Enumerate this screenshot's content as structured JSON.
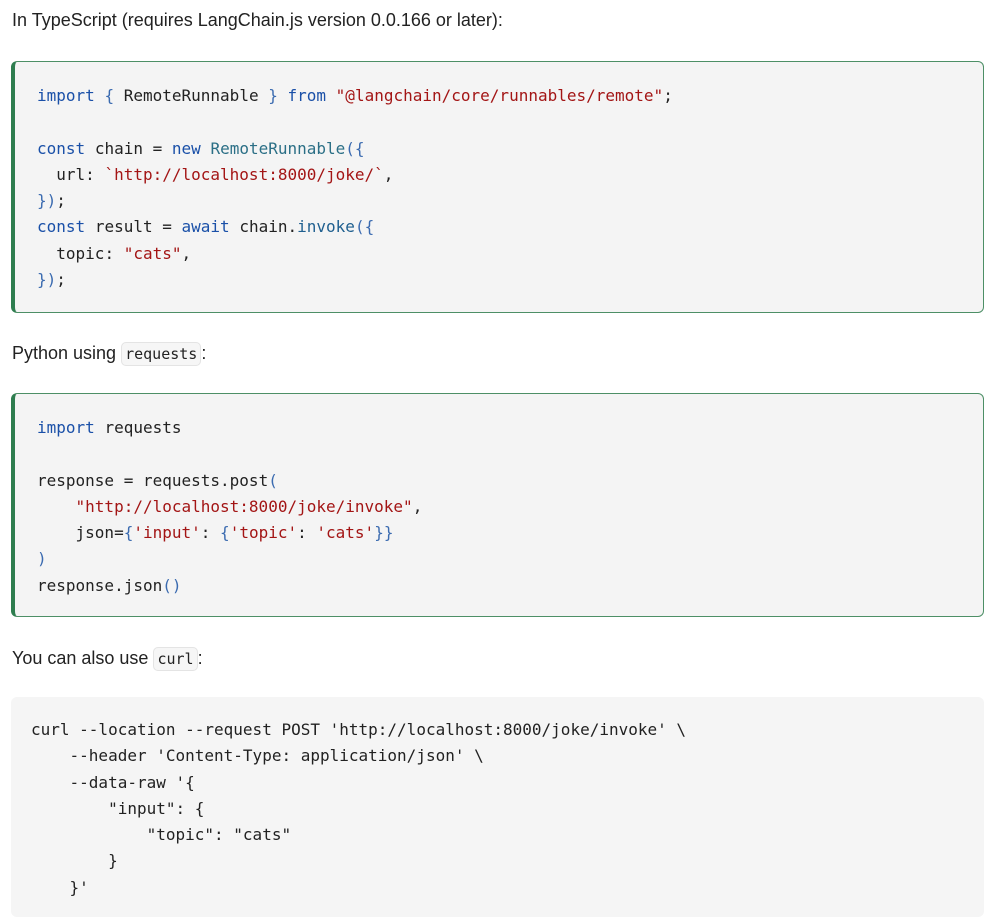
{
  "paragraphs": {
    "ts_intro": "In TypeScript (requires LangChain.js version 0.0.166 or later):",
    "py_intro_prefix": "Python using ",
    "py_intro_code": "requests",
    "py_intro_suffix": ":",
    "curl_intro_prefix": "You can also use ",
    "curl_intro_code": "curl",
    "curl_intro_suffix": ":"
  },
  "code": {
    "typescript": {
      "import_kw": "import",
      "import_name": "RemoteRunnable",
      "from_kw": "from",
      "module": "\"@langchain/core/runnables/remote\"",
      "const_kw": "const",
      "chain_var": "chain",
      "new_kw": "new",
      "class_name": "RemoteRunnable",
      "url_key": "url",
      "url_value": "`http://localhost:8000/joke/`",
      "result_var": "result",
      "await_kw": "await",
      "invoke_fn": "invoke",
      "topic_key": "topic",
      "topic_value": "\"cats\""
    },
    "python": {
      "import_kw": "import",
      "module": "requests",
      "response_var": "response",
      "post_call": "requests.post",
      "url_value": "\"http://localhost:8000/joke/invoke\"",
      "json_kw": "json",
      "input_key": "'input'",
      "topic_key": "'topic'",
      "topic_value": "'cats'",
      "json_call": "response.json"
    },
    "curl": {
      "line1": "curl --location --request POST 'http://localhost:8000/joke/invoke' \\",
      "line2": "    --header 'Content-Type: application/json' \\",
      "line3": "    --data-raw '{",
      "line4": "        \"input\": {",
      "line5": "            \"topic\": \"cats\"",
      "line6": "        }",
      "line7": "    }'"
    }
  }
}
